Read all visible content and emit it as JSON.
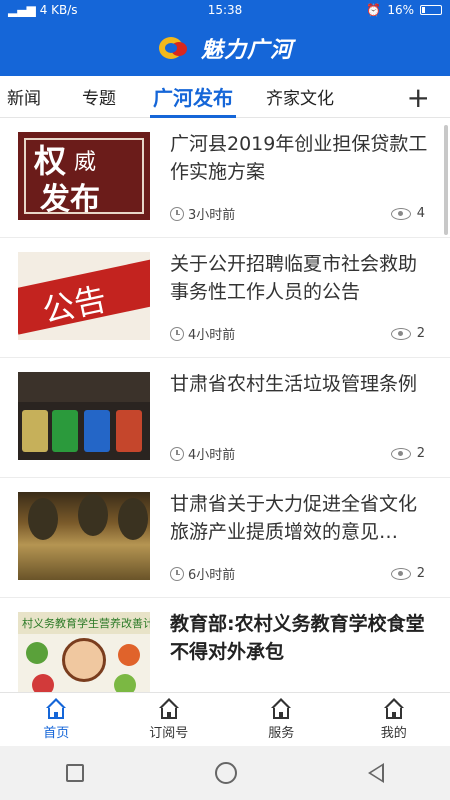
{
  "status_bar": {
    "network": "4 KB/s",
    "time": "15:38",
    "battery": "16%"
  },
  "header": {
    "title": "魅力广河",
    "logo": "app-logo"
  },
  "tabs": [
    {
      "label": "新闻"
    },
    {
      "label": "专题"
    },
    {
      "label": "广河发布",
      "active": true
    },
    {
      "label": "齐家文化"
    }
  ],
  "tab_add_label": "+",
  "feed": [
    {
      "title": "广河县2019年创业担保贷款工作实施方案",
      "time": "3小时前",
      "views": "4",
      "thumb_text_1": "权",
      "thumb_text_2": "威",
      "thumb_text_3": "发布"
    },
    {
      "title": "关于公开招聘临夏市社会救助事务性工作人员的公告",
      "time": "4小时前",
      "views": "2",
      "thumb_text": "公告"
    },
    {
      "title": "甘肃省农村生活垃圾管理条例",
      "time": "4小时前",
      "views": "2"
    },
    {
      "title": "甘肃省关于大力促进全省文化旅游产业提质增效的意见…",
      "time": "6小时前",
      "views": "2"
    },
    {
      "title": "教育部:农村义务教育学校食堂不得对外承包",
      "time": "",
      "views": "",
      "thumb_text": "村义务教育学生营养改善计"
    }
  ],
  "bottom_nav": [
    {
      "label": "首页",
      "active": true
    },
    {
      "label": "订阅号"
    },
    {
      "label": "服务"
    },
    {
      "label": "我的"
    }
  ],
  "colors": {
    "brand_blue": "#1566d8",
    "accent_red": "#c3231f"
  }
}
